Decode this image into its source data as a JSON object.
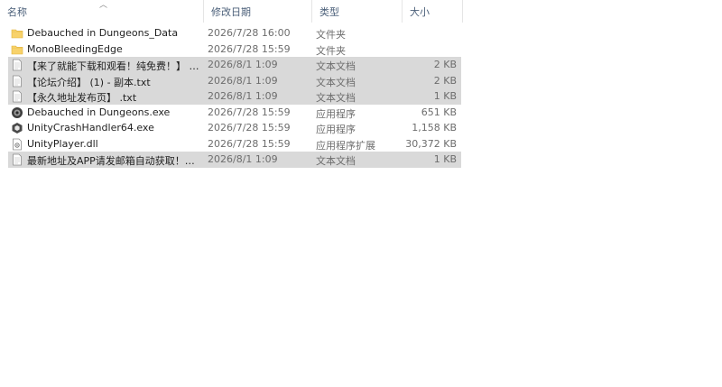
{
  "columns": {
    "name": "名称",
    "date": "修改日期",
    "type": "类型",
    "size": "大小"
  },
  "files": [
    {
      "name": "Debauched in Dungeons_Data",
      "date": "2026/7/28 16:00",
      "type": "文件夹",
      "size": "",
      "icon": "folder-icon",
      "selected": false
    },
    {
      "name": "MonoBleedingEdge",
      "date": "2026/7/28 15:59",
      "type": "文件夹",
      "size": "",
      "icon": "folder-icon",
      "selected": false
    },
    {
      "name": "【来了就能下载和观看！纯免费！】 - 副...",
      "date": "2026/8/1 1:09",
      "type": "文本文档",
      "size": "2 KB",
      "icon": "document-icon",
      "selected": true
    },
    {
      "name": "【论坛介绍】 (1) - 副本.txt",
      "date": "2026/8/1 1:09",
      "type": "文本文档",
      "size": "2 KB",
      "icon": "document-icon",
      "selected": true
    },
    {
      "name": "【永久地址发布页】 .txt",
      "date": "2026/8/1 1:09",
      "type": "文本文档",
      "size": "1 KB",
      "icon": "document-icon",
      "selected": true
    },
    {
      "name": "Debauched in Dungeons.exe",
      "date": "2026/7/28 15:59",
      "type": "应用程序",
      "size": "651 KB",
      "icon": "game-exe-icon",
      "selected": false
    },
    {
      "name": "UnityCrashHandler64.exe",
      "date": "2026/7/28 15:59",
      "type": "应用程序",
      "size": "1,158 KB",
      "icon": "unity-exe-icon",
      "selected": false
    },
    {
      "name": "UnityPlayer.dll",
      "date": "2026/7/28 15:59",
      "type": "应用程序扩展",
      "size": "30,372 KB",
      "icon": "dll-icon",
      "selected": false
    },
    {
      "name": "最新地址及APP请发邮箱自动获取！！！...",
      "date": "2026/8/1 1:09",
      "type": "文本文档",
      "size": "1 KB",
      "icon": "document-icon",
      "selected": true
    }
  ]
}
